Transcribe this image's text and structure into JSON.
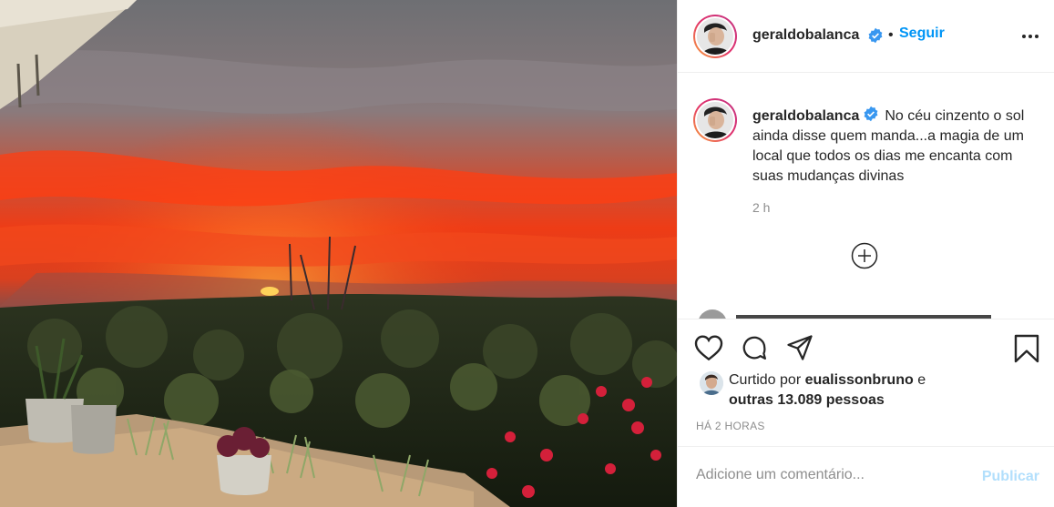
{
  "post": {
    "photo": {
      "icon": "sunset-landscape-photo"
    }
  },
  "header": {
    "username": "geraldobalanca",
    "verified_icon": "verified-badge-icon",
    "separator": "•",
    "follow_label": "Seguir",
    "more_icon": "more-options-icon"
  },
  "caption": {
    "username": "geraldobalanca",
    "text": "No céu cinzento o sol ainda disse quem manda...a magia de um local que todos os dias me encanta com suas mudanças divinas",
    "time": "2 h",
    "load_more_icon": "plus-circle-icon"
  },
  "actions": {
    "like_icon": "heart-icon",
    "comment_icon": "comment-icon",
    "share_icon": "share-icon",
    "save_icon": "bookmark-icon"
  },
  "likes": {
    "prefix": "Curtido por",
    "liker": "eualissonbruno",
    "suffix": "e",
    "others": "outras 13.089 pessoas"
  },
  "posted_ago": "HÁ 2 HORAS",
  "comment": {
    "placeholder": "Adicione um comentário...",
    "publish_label": "Publicar"
  },
  "colors": {
    "accent": "#0095f6",
    "publish_disabled": "#b2dffc",
    "text": "#262626",
    "muted": "#8e8e8e",
    "border": "#efefef"
  }
}
